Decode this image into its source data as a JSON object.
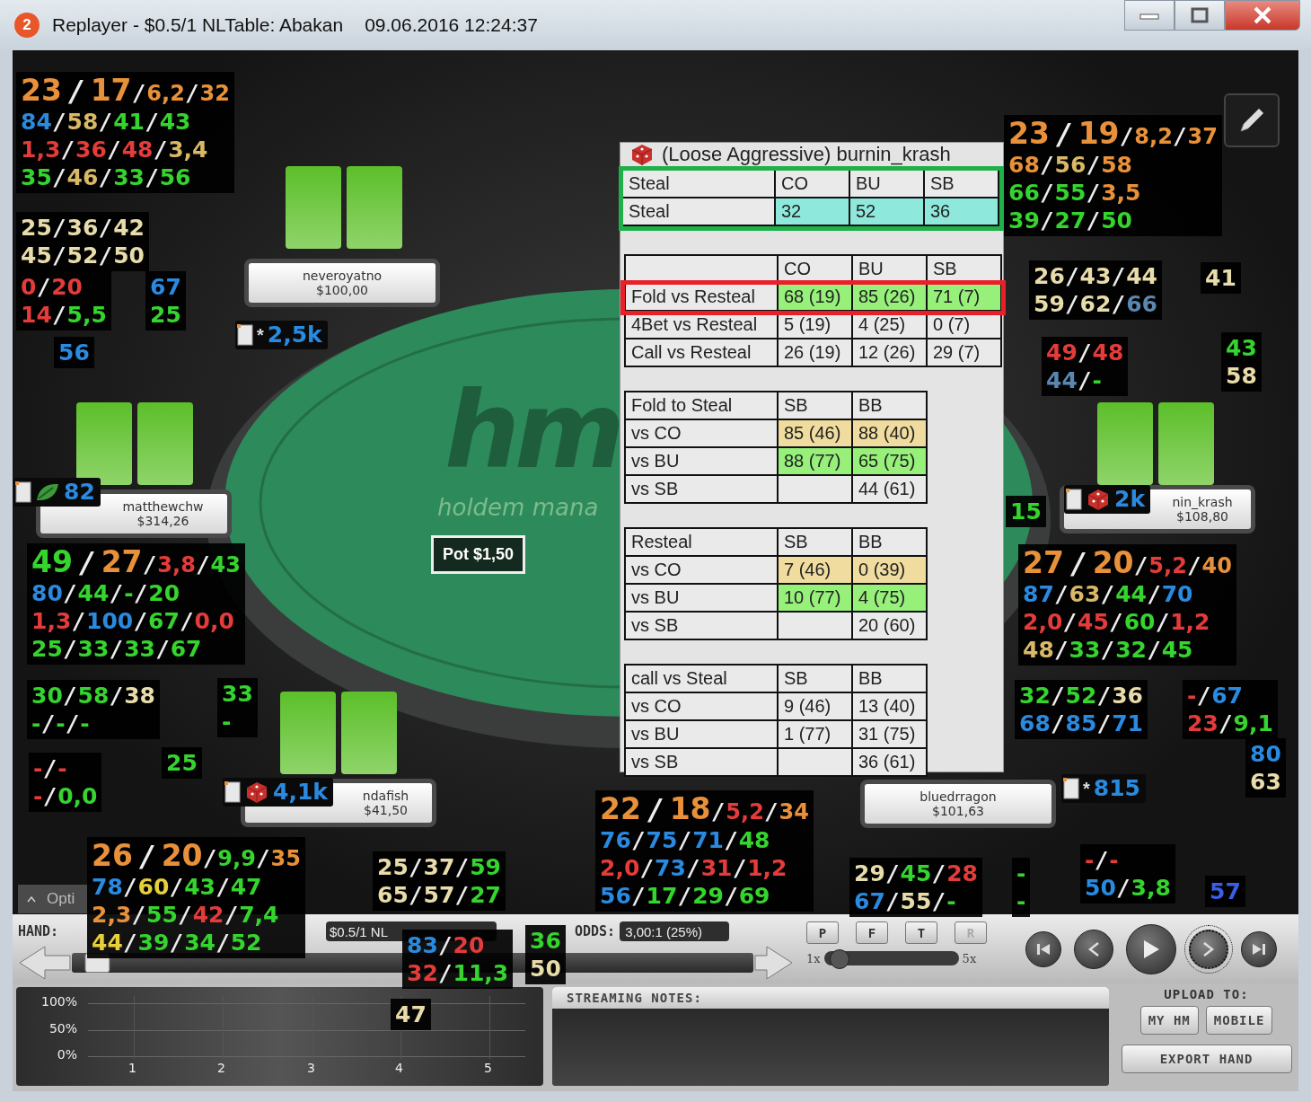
{
  "window": {
    "badge": "2",
    "title": "Replayer - $0.5/1 NLTable: Abakan",
    "datetime": "09.06.2016 12:24:37"
  },
  "table": {
    "logo": "hm",
    "tagline": "holdem mana",
    "pot": "Pot $1,50"
  },
  "players": [
    {
      "name": "neveroyatno",
      "stack": "$100,00",
      "badge": {
        "kind": "star",
        "mark": "*",
        "value": "2,5k"
      }
    },
    {
      "name": "matthewchw",
      "stack": "$314,26",
      "badge": {
        "kind": "leaf",
        "value": "82"
      }
    },
    {
      "name": "nin_krash",
      "stack": "$108,80",
      "badge": {
        "kind": "dice",
        "value": "2k"
      }
    },
    {
      "name": "ndafish",
      "stack": "$41,50",
      "badge": {
        "kind": "dice",
        "value": "4,1k"
      }
    },
    {
      "name": "bluedrragon",
      "stack": "$101,63",
      "badge": {
        "kind": "star",
        "mark": "*",
        "value": "815"
      }
    }
  ],
  "huds": [
    {
      "kind": "main",
      "separator": "/",
      "lines": [
        [
          {
            "v": "23",
            "color": "#e8913a"
          },
          {
            "v": "17",
            "color": "#e8913a"
          },
          {
            "v": "6,2",
            "color": "#e8913a"
          },
          {
            "v": "32",
            "color": "#e8913a"
          }
        ],
        [
          {
            "v": "84",
            "color": "#2a8ae0"
          },
          {
            "v": "58",
            "color": "#d9b866"
          },
          {
            "v": "41",
            "color": "#35d42e"
          },
          {
            "v": "43",
            "color": "#35d42e"
          }
        ],
        [
          {
            "v": "1,3",
            "color": "#e43b3b"
          },
          {
            "v": "36",
            "color": "#e43b3b"
          },
          {
            "v": "48",
            "color": "#e43b3b"
          },
          {
            "v": "3,4",
            "color": "#d9b866"
          }
        ],
        [
          {
            "v": "35",
            "color": "#35d42e"
          },
          {
            "v": "46",
            "color": "#d9b866"
          },
          {
            "v": "33",
            "color": "#35d42e"
          },
          {
            "v": "56",
            "color": "#35d42e"
          }
        ]
      ]
    },
    {
      "kind": "mini",
      "separator": "/",
      "lines": [
        [
          {
            "v": "25",
            "color": "#e8dcaa"
          },
          {
            "v": "36",
            "color": "#e8dcaa"
          },
          {
            "v": "42",
            "color": "#e8dcaa"
          }
        ],
        [
          {
            "v": "45",
            "color": "#e8dcaa"
          },
          {
            "v": "52",
            "color": "#e8dcaa"
          },
          {
            "v": "50",
            "color": "#e8dcaa"
          }
        ]
      ]
    },
    {
      "kind": "mini",
      "separator": "/",
      "lines": [
        [
          {
            "v": "0",
            "color": "#e43b3b"
          },
          {
            "v": "20",
            "color": "#e43b3b"
          }
        ],
        [
          {
            "v": "14",
            "color": "#e43b3b"
          },
          {
            "v": "5,5",
            "color": "#35d42e"
          }
        ]
      ]
    },
    {
      "kind": "mini",
      "lines": [
        [
          {
            "v": "67",
            "color": "#2a8ae0"
          }
        ],
        [
          {
            "v": "25",
            "color": "#35d42e"
          }
        ]
      ]
    },
    {
      "kind": "mini",
      "lines": [
        [
          {
            "v": "56",
            "color": "#2a8ae0"
          }
        ]
      ]
    },
    {
      "kind": "main",
      "separator": "/",
      "lines": [
        [
          {
            "v": "23",
            "color": "#e8913a"
          },
          {
            "v": "19",
            "color": "#e8913a"
          },
          {
            "v": "8,2",
            "color": "#e8913a"
          },
          {
            "v": "37",
            "color": "#e8913a"
          }
        ],
        [
          {
            "v": "68",
            "color": "#e8913a"
          },
          {
            "v": "56",
            "color": "#d9b866"
          },
          {
            "v": "58",
            "color": "#e8913a"
          }
        ],
        [
          {
            "v": "66",
            "color": "#35d42e"
          },
          {
            "v": "55",
            "color": "#35d42e"
          },
          {
            "v": "3,5",
            "color": "#e8913a"
          }
        ],
        [
          {
            "v": "39",
            "color": "#35d42e"
          },
          {
            "v": "27",
            "color": "#35d42e"
          },
          {
            "v": "50",
            "color": "#35d42e"
          }
        ]
      ]
    },
    {
      "kind": "mini",
      "separator": "/",
      "lines": [
        [
          {
            "v": "26",
            "color": "#e8dcaa"
          },
          {
            "v": "43",
            "color": "#e8dcaa"
          },
          {
            "v": "44",
            "color": "#e8dcaa"
          }
        ],
        [
          {
            "v": "59",
            "color": "#e8dcaa"
          },
          {
            "v": "62",
            "color": "#e8dcaa"
          },
          {
            "v": "66",
            "color": "#5a86b0"
          }
        ]
      ]
    },
    {
      "kind": "mini",
      "lines": [
        [
          {
            "v": "41",
            "color": "#e8dcaa"
          }
        ]
      ]
    },
    {
      "kind": "mini",
      "separator": "/",
      "lines": [
        [
          {
            "v": "49",
            "color": "#e43b3b"
          },
          {
            "v": "48",
            "color": "#e43b3b"
          }
        ],
        [
          {
            "v": "44",
            "color": "#5a86b0"
          },
          {
            "v": "-",
            "color": "#35d42e"
          }
        ]
      ]
    },
    {
      "kind": "mini",
      "lines": [
        [
          {
            "v": "43",
            "color": "#35d42e"
          }
        ],
        [
          {
            "v": "58",
            "color": "#e8dcaa"
          }
        ]
      ]
    },
    {
      "kind": "mini",
      "lines": [
        [
          {
            "v": "15",
            "color": "#35d42e"
          }
        ]
      ]
    },
    {
      "kind": "main",
      "separator": "/",
      "lines": [
        [
          {
            "v": "49",
            "color": "#35d42e"
          },
          {
            "v": "27",
            "color": "#e8913a"
          },
          {
            "v": "3,8",
            "color": "#e43b3b"
          },
          {
            "v": "43",
            "color": "#35d42e"
          }
        ],
        [
          {
            "v": "80",
            "color": "#2a8ae0"
          },
          {
            "v": "44",
            "color": "#35d42e"
          },
          {
            "v": "-",
            "color": "#35d42e"
          },
          {
            "v": "20",
            "color": "#35d42e"
          }
        ],
        [
          {
            "v": "1,3",
            "color": "#e43b3b"
          },
          {
            "v": "100",
            "color": "#2a8ae0"
          },
          {
            "v": "67",
            "color": "#35d42e"
          },
          {
            "v": "0,0",
            "color": "#e43b3b"
          }
        ],
        [
          {
            "v": "25",
            "color": "#35d42e"
          },
          {
            "v": "33",
            "color": "#35d42e"
          },
          {
            "v": "33",
            "color": "#35d42e"
          },
          {
            "v": "67",
            "color": "#35d42e"
          }
        ]
      ]
    },
    {
      "kind": "main",
      "separator": "/",
      "lines": [
        [
          {
            "v": "27",
            "color": "#e8913a"
          },
          {
            "v": "20",
            "color": "#e8913a"
          },
          {
            "v": "5,2",
            "color": "#e43b3b"
          },
          {
            "v": "40",
            "color": "#e8913a"
          }
        ],
        [
          {
            "v": "87",
            "color": "#2a8ae0"
          },
          {
            "v": "63",
            "color": "#d9b866"
          },
          {
            "v": "44",
            "color": "#35d42e"
          },
          {
            "v": "70",
            "color": "#2a8ae0"
          }
        ],
        [
          {
            "v": "2,0",
            "color": "#e43b3b"
          },
          {
            "v": "45",
            "color": "#e43b3b"
          },
          {
            "v": "60",
            "color": "#35d42e"
          },
          {
            "v": "1,2",
            "color": "#e43b3b"
          }
        ],
        [
          {
            "v": "48",
            "color": "#d9b866"
          },
          {
            "v": "33",
            "color": "#35d42e"
          },
          {
            "v": "32",
            "color": "#35d42e"
          },
          {
            "v": "45",
            "color": "#35d42e"
          }
        ]
      ]
    },
    {
      "kind": "mini",
      "separator": "/",
      "lines": [
        [
          {
            "v": "30",
            "color": "#35d42e"
          },
          {
            "v": "58",
            "color": "#35d42e"
          },
          {
            "v": "38",
            "color": "#e8dcaa"
          }
        ],
        [
          {
            "v": "-",
            "color": "#35d42e"
          },
          {
            "v": "-",
            "color": "#35d42e"
          },
          {
            "v": "-",
            "color": "#35d42e"
          }
        ]
      ]
    },
    {
      "kind": "mini",
      "lines": [
        [
          {
            "v": "33",
            "color": "#35d42e"
          }
        ],
        [
          {
            "v": "-",
            "color": "#35d42e"
          }
        ]
      ]
    },
    {
      "kind": "mini",
      "separator": "/",
      "lines": [
        [
          {
            "v": "-",
            "color": "#e43b3b"
          },
          {
            "v": "-",
            "color": "#e43b3b"
          }
        ],
        [
          {
            "v": "-",
            "color": "#e43b3b"
          },
          {
            "v": "0,0",
            "color": "#35d42e"
          }
        ]
      ]
    },
    {
      "kind": "mini",
      "lines": [
        [
          {
            "v": "25",
            "color": "#35d42e"
          }
        ]
      ]
    },
    {
      "kind": "mini",
      "separator": "/",
      "lines": [
        [
          {
            "v": "32",
            "color": "#35d42e"
          },
          {
            "v": "52",
            "color": "#35d42e"
          },
          {
            "v": "36",
            "color": "#e8dcaa"
          }
        ],
        [
          {
            "v": "68",
            "color": "#2a8ae0"
          },
          {
            "v": "85",
            "color": "#2a8ae0"
          },
          {
            "v": "71",
            "color": "#2a8ae0"
          }
        ]
      ]
    },
    {
      "kind": "mini",
      "separator": "/",
      "lines": [
        [
          {
            "v": "-",
            "color": "#e43b3b"
          },
          {
            "v": "67",
            "color": "#2a8ae0"
          }
        ],
        [
          {
            "v": "23",
            "color": "#e43b3b"
          },
          {
            "v": "9,1",
            "color": "#35d42e"
          }
        ]
      ]
    },
    {
      "kind": "mini",
      "lines": [
        [
          {
            "v": "80",
            "color": "#2a8ae0"
          }
        ],
        [
          {
            "v": "63",
            "color": "#e8dcaa"
          }
        ]
      ]
    },
    {
      "kind": "main",
      "separator": "/",
      "lines": [
        [
          {
            "v": "22",
            "color": "#e8913a"
          },
          {
            "v": "18",
            "color": "#e8913a"
          },
          {
            "v": "5,2",
            "color": "#e43b3b"
          },
          {
            "v": "34",
            "color": "#e8913a"
          }
        ],
        [
          {
            "v": "76",
            "color": "#2a8ae0"
          },
          {
            "v": "75",
            "color": "#2a8ae0"
          },
          {
            "v": "71",
            "color": "#2a8ae0"
          },
          {
            "v": "48",
            "color": "#35d42e"
          }
        ],
        [
          {
            "v": "2,0",
            "color": "#e43b3b"
          },
          {
            "v": "73",
            "color": "#2a8ae0"
          },
          {
            "v": "31",
            "color": "#e43b3b"
          },
          {
            "v": "1,2",
            "color": "#e43b3b"
          }
        ],
        [
          {
            "v": "56",
            "color": "#2a8ae0"
          },
          {
            "v": "17",
            "color": "#35d42e"
          },
          {
            "v": "29",
            "color": "#35d42e"
          },
          {
            "v": "69",
            "color": "#35d42e"
          }
        ]
      ]
    },
    {
      "kind": "main",
      "separator": "/",
      "lines": [
        [
          {
            "v": "26",
            "color": "#e8913a"
          },
          {
            "v": "20",
            "color": "#e8913a"
          },
          {
            "v": "9,9",
            "color": "#35d42e"
          },
          {
            "v": "35",
            "color": "#e8913a"
          }
        ],
        [
          {
            "v": "78",
            "color": "#2a8ae0"
          },
          {
            "v": "60",
            "color": "#e6cf3a"
          },
          {
            "v": "43",
            "color": "#35d42e"
          },
          {
            "v": "47",
            "color": "#35d42e"
          }
        ],
        [
          {
            "v": "2,3",
            "color": "#e8913a"
          },
          {
            "v": "55",
            "color": "#35d42e"
          },
          {
            "v": "42",
            "color": "#e43b3b"
          },
          {
            "v": "7,4",
            "color": "#35d42e"
          }
        ],
        [
          {
            "v": "44",
            "color": "#e6cf3a"
          },
          {
            "v": "39",
            "color": "#35d42e"
          },
          {
            "v": "34",
            "color": "#35d42e"
          },
          {
            "v": "52",
            "color": "#35d42e"
          }
        ]
      ]
    },
    {
      "kind": "mini",
      "separator": "/",
      "lines": [
        [
          {
            "v": "25",
            "color": "#e8dcaa"
          },
          {
            "v": "37",
            "color": "#e8dcaa"
          },
          {
            "v": "59",
            "color": "#35d42e"
          }
        ],
        [
          {
            "v": "65",
            "color": "#e8dcaa"
          },
          {
            "v": "57",
            "color": "#e8dcaa"
          },
          {
            "v": "27",
            "color": "#35d42e"
          }
        ]
      ]
    },
    {
      "kind": "mini",
      "separator": "/",
      "lines": [
        [
          {
            "v": "29",
            "color": "#e8dcaa"
          },
          {
            "v": "45",
            "color": "#35d42e"
          },
          {
            "v": "28",
            "color": "#e43b3b"
          }
        ],
        [
          {
            "v": "67",
            "color": "#2a8ae0"
          },
          {
            "v": "55",
            "color": "#e8dcaa"
          },
          {
            "v": "-",
            "color": "#35d42e"
          }
        ]
      ]
    },
    {
      "kind": "mini",
      "lines": [
        [
          {
            "v": "-",
            "color": "#35d42e"
          }
        ],
        [
          {
            "v": "-",
            "color": "#35d42e"
          }
        ]
      ]
    },
    {
      "kind": "mini",
      "separator": "/",
      "lines": [
        [
          {
            "v": "-",
            "color": "#e43b3b"
          },
          {
            "v": "-",
            "color": "#e43b3b"
          }
        ],
        [
          {
            "v": "50",
            "color": "#2a8ae0"
          },
          {
            "v": "3,8",
            "color": "#35d42e"
          }
        ]
      ]
    },
    {
      "kind": "mini",
      "lines": [
        [
          {
            "v": "57",
            "color": "#3a5ee6"
          }
        ]
      ]
    },
    {
      "kind": "mini",
      "separator": "/",
      "lines": [
        [
          {
            "v": "83",
            "color": "#2a8ae0"
          },
          {
            "v": "20",
            "color": "#e43b3b"
          }
        ],
        [
          {
            "v": "32",
            "color": "#e43b3b"
          },
          {
            "v": "11,3",
            "color": "#35d42e"
          }
        ]
      ]
    },
    {
      "kind": "mini",
      "lines": [
        [
          {
            "v": "36",
            "color": "#35d42e"
          }
        ],
        [
          {
            "v": "50",
            "color": "#e8dcaa"
          }
        ]
      ]
    },
    {
      "kind": "mini",
      "lines": [
        [
          {
            "v": "47",
            "color": "#e8dcaa"
          }
        ]
      ]
    }
  ],
  "popup": {
    "title": "(Loose Aggressive) burnin_krash",
    "tables": [
      {
        "color": "#1fb04a",
        "title": "Steal",
        "columns": [
          "CO",
          "BU",
          "SB"
        ],
        "rows": [
          {
            "label": "Steal",
            "cells": [
              {
                "v": "32",
                "color": "#8ee8dc"
              },
              {
                "v": "52",
                "color": "#8ee8dc"
              },
              {
                "v": "36",
                "color": "#8ee8dc"
              }
            ]
          }
        ]
      },
      {
        "columns": [
          "CO",
          "BU",
          "SB"
        ],
        "rows": [
          {
            "label": "Fold vs Resteal",
            "color": "#e8202a",
            "cells": [
              {
                "v": "68 (19)",
                "color": "#96f07a"
              },
              {
                "v": "85 (26)",
                "color": "#96f07a"
              },
              {
                "v": "71 (7)",
                "color": "#96f07a"
              }
            ]
          },
          {
            "label": "4Bet vs Resteal",
            "cells": [
              {
                "v": "5 (19)"
              },
              {
                "v": "4 (25)"
              },
              {
                "v": "0 (7)"
              }
            ]
          },
          {
            "label": "Call vs Resteal",
            "cells": [
              {
                "v": "26 (19)"
              },
              {
                "v": "12 (26)"
              },
              {
                "v": "29 (7)"
              }
            ]
          }
        ]
      },
      {
        "title": "Fold to Steal",
        "columns": [
          "SB",
          "BB"
        ],
        "rows": [
          {
            "label": "vs CO",
            "cells": [
              {
                "v": "85 (46)",
                "color": "#f0dc9e"
              },
              {
                "v": "88 (40)",
                "color": "#f0dc9e"
              }
            ]
          },
          {
            "label": "vs BU",
            "cells": [
              {
                "v": "88 (77)",
                "color": "#96f07a"
              },
              {
                "v": "65 (75)",
                "color": "#96f07a"
              }
            ]
          },
          {
            "label": "vs SB",
            "cells": [
              {},
              {
                "v": "44 (61)"
              }
            ]
          }
        ]
      },
      {
        "title": "Resteal",
        "columns": [
          "SB",
          "BB"
        ],
        "rows": [
          {
            "label": "vs CO",
            "cells": [
              {
                "v": "7 (46)",
                "color": "#f0dc9e"
              },
              {
                "v": "0 (39)",
                "color": "#f0dc9e"
              }
            ]
          },
          {
            "label": "vs BU",
            "cells": [
              {
                "v": "10 (77)",
                "color": "#96f07a"
              },
              {
                "v": "4 (75)",
                "color": "#96f07a"
              }
            ]
          },
          {
            "label": "vs SB",
            "cells": [
              {},
              {
                "v": "20 (60)"
              }
            ]
          }
        ]
      },
      {
        "title": "call vs Steal",
        "columns": [
          "SB",
          "BB"
        ],
        "rows": [
          {
            "label": "vs CO",
            "cells": [
              {
                "v": "9 (46)"
              },
              {
                "v": "13 (40)"
              }
            ]
          },
          {
            "label": "vs BU",
            "cells": [
              {
                "v": "1 (77)"
              },
              {
                "v": "31 (75)"
              }
            ]
          },
          {
            "label": "vs SB",
            "cells": [
              {},
              {
                "v": "36 (61)"
              }
            ]
          }
        ]
      }
    ]
  },
  "controls": {
    "options_tab": "Opti",
    "hand_label": "HAND:",
    "hand_value": "$0.5/1 NL",
    "odds_label": "ODDS:",
    "odds_value": "3,00:1 (25%)",
    "progress": {
      "level": 0.02
    },
    "street_buttons": [
      {
        "label": "P",
        "disabled": false
      },
      {
        "label": "F",
        "disabled": false
      },
      {
        "label": "T",
        "disabled": false
      },
      {
        "label": "R",
        "disabled": true
      }
    ],
    "speed": {
      "min_label": "1x",
      "max_label": "5x",
      "level": 0.05
    },
    "nav_buttons": [
      {
        "kind": "first",
        "focused": false
      },
      {
        "kind": "prev",
        "focused": false
      },
      {
        "kind": "play",
        "focused": false
      },
      {
        "kind": "next",
        "focused": true
      },
      {
        "kind": "last",
        "focused": false
      }
    ]
  },
  "equity_graph": {
    "y_labels": [
      "100%",
      "50%",
      "0%"
    ],
    "x_labels": [
      "1",
      "2",
      "3",
      "4",
      "5"
    ]
  },
  "streaming_notes": {
    "label": "STREAMING NOTES:"
  },
  "upload": {
    "label": "UPLOAD TO:",
    "buttons": [
      "MY HM",
      "MOBILE"
    ],
    "export": "EXPORT HAND"
  }
}
